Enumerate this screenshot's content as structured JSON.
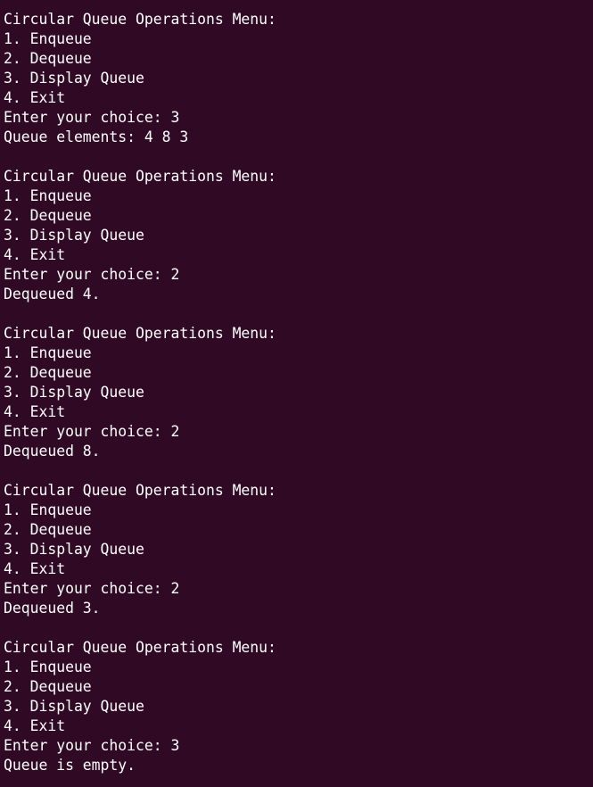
{
  "colors": {
    "background": "#300a24",
    "foreground": "#ffffff"
  },
  "terminal": {
    "lines": [
      "Circular Queue Operations Menu:",
      "1. Enqueue",
      "2. Dequeue",
      "3. Display Queue",
      "4. Exit",
      "Enter your choice: 3",
      "Queue elements: 4 8 3",
      "",
      "Circular Queue Operations Menu:",
      "1. Enqueue",
      "2. Dequeue",
      "3. Display Queue",
      "4. Exit",
      "Enter your choice: 2",
      "Dequeued 4.",
      "",
      "Circular Queue Operations Menu:",
      "1. Enqueue",
      "2. Dequeue",
      "3. Display Queue",
      "4. Exit",
      "Enter your choice: 2",
      "Dequeued 8.",
      "",
      "Circular Queue Operations Menu:",
      "1. Enqueue",
      "2. Dequeue",
      "3. Display Queue",
      "4. Exit",
      "Enter your choice: 2",
      "Dequeued 3.",
      "",
      "Circular Queue Operations Menu:",
      "1. Enqueue",
      "2. Dequeue",
      "3. Display Queue",
      "4. Exit",
      "Enter your choice: 3",
      "Queue is empty."
    ]
  }
}
